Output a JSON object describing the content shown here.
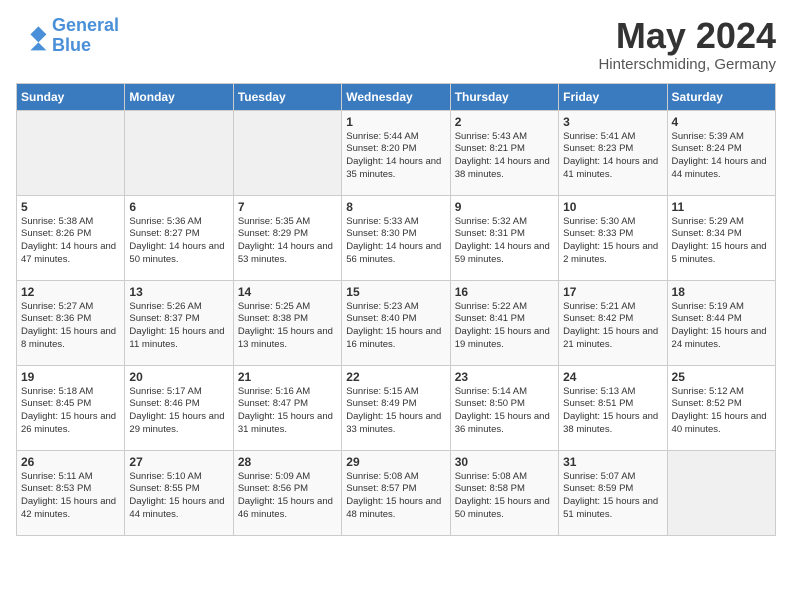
{
  "header": {
    "logo_line1": "General",
    "logo_line2": "Blue",
    "month": "May 2024",
    "location": "Hinterschmiding, Germany"
  },
  "weekdays": [
    "Sunday",
    "Monday",
    "Tuesday",
    "Wednesday",
    "Thursday",
    "Friday",
    "Saturday"
  ],
  "weeks": [
    [
      {
        "day": "",
        "info": ""
      },
      {
        "day": "",
        "info": ""
      },
      {
        "day": "",
        "info": ""
      },
      {
        "day": "1",
        "info": "Sunrise: 5:44 AM\nSunset: 8:20 PM\nDaylight: 14 hours\nand 35 minutes."
      },
      {
        "day": "2",
        "info": "Sunrise: 5:43 AM\nSunset: 8:21 PM\nDaylight: 14 hours\nand 38 minutes."
      },
      {
        "day": "3",
        "info": "Sunrise: 5:41 AM\nSunset: 8:23 PM\nDaylight: 14 hours\nand 41 minutes."
      },
      {
        "day": "4",
        "info": "Sunrise: 5:39 AM\nSunset: 8:24 PM\nDaylight: 14 hours\nand 44 minutes."
      }
    ],
    [
      {
        "day": "5",
        "info": "Sunrise: 5:38 AM\nSunset: 8:26 PM\nDaylight: 14 hours\nand 47 minutes."
      },
      {
        "day": "6",
        "info": "Sunrise: 5:36 AM\nSunset: 8:27 PM\nDaylight: 14 hours\nand 50 minutes."
      },
      {
        "day": "7",
        "info": "Sunrise: 5:35 AM\nSunset: 8:29 PM\nDaylight: 14 hours\nand 53 minutes."
      },
      {
        "day": "8",
        "info": "Sunrise: 5:33 AM\nSunset: 8:30 PM\nDaylight: 14 hours\nand 56 minutes."
      },
      {
        "day": "9",
        "info": "Sunrise: 5:32 AM\nSunset: 8:31 PM\nDaylight: 14 hours\nand 59 minutes."
      },
      {
        "day": "10",
        "info": "Sunrise: 5:30 AM\nSunset: 8:33 PM\nDaylight: 15 hours\nand 2 minutes."
      },
      {
        "day": "11",
        "info": "Sunrise: 5:29 AM\nSunset: 8:34 PM\nDaylight: 15 hours\nand 5 minutes."
      }
    ],
    [
      {
        "day": "12",
        "info": "Sunrise: 5:27 AM\nSunset: 8:36 PM\nDaylight: 15 hours\nand 8 minutes."
      },
      {
        "day": "13",
        "info": "Sunrise: 5:26 AM\nSunset: 8:37 PM\nDaylight: 15 hours\nand 11 minutes."
      },
      {
        "day": "14",
        "info": "Sunrise: 5:25 AM\nSunset: 8:38 PM\nDaylight: 15 hours\nand 13 minutes."
      },
      {
        "day": "15",
        "info": "Sunrise: 5:23 AM\nSunset: 8:40 PM\nDaylight: 15 hours\nand 16 minutes."
      },
      {
        "day": "16",
        "info": "Sunrise: 5:22 AM\nSunset: 8:41 PM\nDaylight: 15 hours\nand 19 minutes."
      },
      {
        "day": "17",
        "info": "Sunrise: 5:21 AM\nSunset: 8:42 PM\nDaylight: 15 hours\nand 21 minutes."
      },
      {
        "day": "18",
        "info": "Sunrise: 5:19 AM\nSunset: 8:44 PM\nDaylight: 15 hours\nand 24 minutes."
      }
    ],
    [
      {
        "day": "19",
        "info": "Sunrise: 5:18 AM\nSunset: 8:45 PM\nDaylight: 15 hours\nand 26 minutes."
      },
      {
        "day": "20",
        "info": "Sunrise: 5:17 AM\nSunset: 8:46 PM\nDaylight: 15 hours\nand 29 minutes."
      },
      {
        "day": "21",
        "info": "Sunrise: 5:16 AM\nSunset: 8:47 PM\nDaylight: 15 hours\nand 31 minutes."
      },
      {
        "day": "22",
        "info": "Sunrise: 5:15 AM\nSunset: 8:49 PM\nDaylight: 15 hours\nand 33 minutes."
      },
      {
        "day": "23",
        "info": "Sunrise: 5:14 AM\nSunset: 8:50 PM\nDaylight: 15 hours\nand 36 minutes."
      },
      {
        "day": "24",
        "info": "Sunrise: 5:13 AM\nSunset: 8:51 PM\nDaylight: 15 hours\nand 38 minutes."
      },
      {
        "day": "25",
        "info": "Sunrise: 5:12 AM\nSunset: 8:52 PM\nDaylight: 15 hours\nand 40 minutes."
      }
    ],
    [
      {
        "day": "26",
        "info": "Sunrise: 5:11 AM\nSunset: 8:53 PM\nDaylight: 15 hours\nand 42 minutes."
      },
      {
        "day": "27",
        "info": "Sunrise: 5:10 AM\nSunset: 8:55 PM\nDaylight: 15 hours\nand 44 minutes."
      },
      {
        "day": "28",
        "info": "Sunrise: 5:09 AM\nSunset: 8:56 PM\nDaylight: 15 hours\nand 46 minutes."
      },
      {
        "day": "29",
        "info": "Sunrise: 5:08 AM\nSunset: 8:57 PM\nDaylight: 15 hours\nand 48 minutes."
      },
      {
        "day": "30",
        "info": "Sunrise: 5:08 AM\nSunset: 8:58 PM\nDaylight: 15 hours\nand 50 minutes."
      },
      {
        "day": "31",
        "info": "Sunrise: 5:07 AM\nSunset: 8:59 PM\nDaylight: 15 hours\nand 51 minutes."
      },
      {
        "day": "",
        "info": ""
      }
    ]
  ]
}
